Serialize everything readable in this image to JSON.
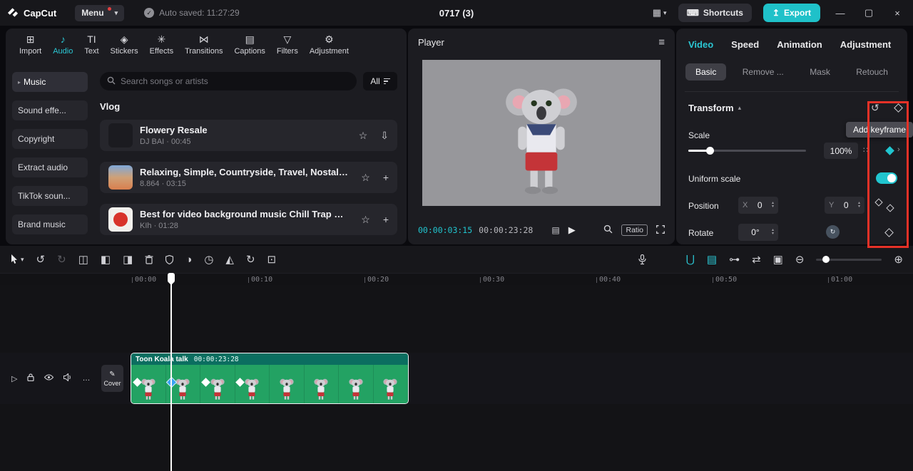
{
  "topbar": {
    "brand": "CapCut",
    "menu": "Menu",
    "autosave": "Auto saved: 11:27:29",
    "title": "0717 (3)",
    "shortcuts": "Shortcuts",
    "export": "Export"
  },
  "media_panel": {
    "tabs": [
      {
        "label": "Import"
      },
      {
        "label": "Audio"
      },
      {
        "label": "Text"
      },
      {
        "label": "Stickers"
      },
      {
        "label": "Effects"
      },
      {
        "label": "Transitions"
      },
      {
        "label": "Captions"
      },
      {
        "label": "Filters"
      },
      {
        "label": "Adjustment"
      }
    ],
    "sidebar": [
      {
        "label": "Music"
      },
      {
        "label": "Sound effe..."
      },
      {
        "label": "Copyright"
      },
      {
        "label": "Extract audio"
      },
      {
        "label": "TikTok soun..."
      },
      {
        "label": "Brand music"
      }
    ],
    "search_placeholder": "Search songs or artists",
    "filter_all": "All",
    "section": "Vlog",
    "songs": [
      {
        "title": "Flowery Resale",
        "meta": "DJ BAI · 00:45"
      },
      {
        "title": "Relaxing, Simple, Countryside, Travel, Nostalgic(...",
        "meta": "8.864 · 03:15"
      },
      {
        "title": "Best for video background music Chill Trap Hip H...",
        "meta": "KIh · 01:28"
      }
    ]
  },
  "player": {
    "title": "Player",
    "current_time": "00:00:03:15",
    "total_time": "00:00:23:28",
    "ratio": "Ratio"
  },
  "inspector": {
    "tabs": [
      {
        "label": "Video"
      },
      {
        "label": "Speed"
      },
      {
        "label": "Animation"
      },
      {
        "label": "Adjustment"
      }
    ],
    "subtabs": [
      {
        "label": "Basic"
      },
      {
        "label": "Remove ..."
      },
      {
        "label": "Mask"
      },
      {
        "label": "Retouch"
      }
    ],
    "transform": "Transform",
    "tooltip": "Add keyframe",
    "scale": {
      "label": "Scale",
      "value": "100%"
    },
    "uniform": "Uniform scale",
    "position": {
      "label": "Position",
      "x_label": "X",
      "x_value": "0",
      "y_label": "Y",
      "y_value": "0"
    },
    "rotate": {
      "label": "Rotate",
      "value": "0°"
    }
  },
  "timeline": {
    "ruler": [
      {
        "t": "00:00"
      },
      {
        "t": "00:10"
      },
      {
        "t": "00:20"
      },
      {
        "t": "00:30"
      },
      {
        "t": "00:40"
      },
      {
        "t": "00:50"
      },
      {
        "t": "01:00"
      }
    ],
    "cover": "Cover",
    "clip": {
      "name": "Toon Koala talk",
      "duration": "00:00:23:28"
    }
  },
  "colors": {
    "accent": "#21c5cf",
    "clip_green": "#23a263",
    "keyframe_blue": "#3aa3f2",
    "highlight_red": "#e53127"
  }
}
